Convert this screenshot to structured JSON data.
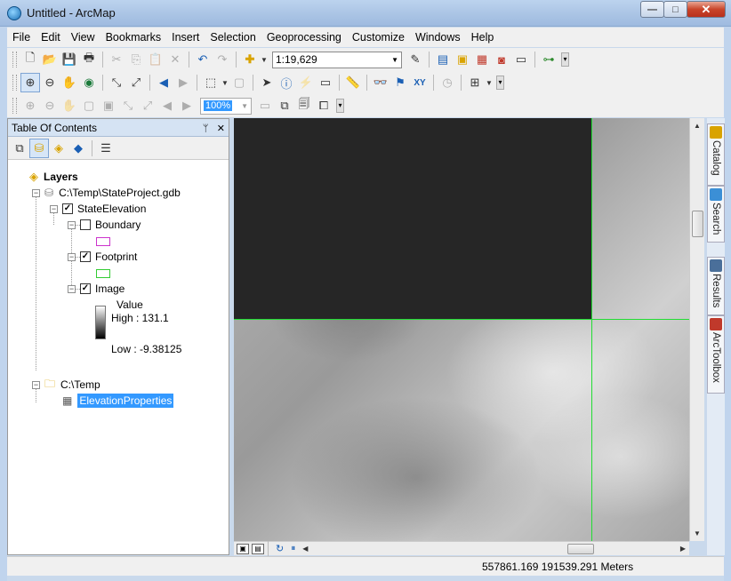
{
  "window": {
    "title": "Untitled - ArcMap",
    "minimize": "—",
    "maximize": "□",
    "close": "✕"
  },
  "menu": [
    "File",
    "Edit",
    "View",
    "Bookmarks",
    "Insert",
    "Selection",
    "Geoprocessing",
    "Customize",
    "Windows",
    "Help"
  ],
  "toolbar": {
    "scale": "1:19,629",
    "zoom_percent": "100%"
  },
  "toc": {
    "title": "Table Of Contents",
    "pin": "ᛘ",
    "close": "✕",
    "layers_label": "Layers",
    "gdb": "C:\\Temp\\StateProject.gdb",
    "group": "StateElevation",
    "boundary": "Boundary",
    "footprint": "Footprint",
    "image": "Image",
    "legend_title": "Value",
    "high": "High : 131.1",
    "low": "Low : -9.38125",
    "folder": "C:\\Temp",
    "table": "ElevationProperties",
    "boundary_color": "#cc33cc",
    "footprint_color": "#33cc33"
  },
  "map": {
    "line_color": "#22dd33"
  },
  "dock": [
    "Catalog",
    "Search",
    "Results",
    "ArcToolbox"
  ],
  "status": {
    "coords": "557861.169  191539.291 Meters"
  }
}
